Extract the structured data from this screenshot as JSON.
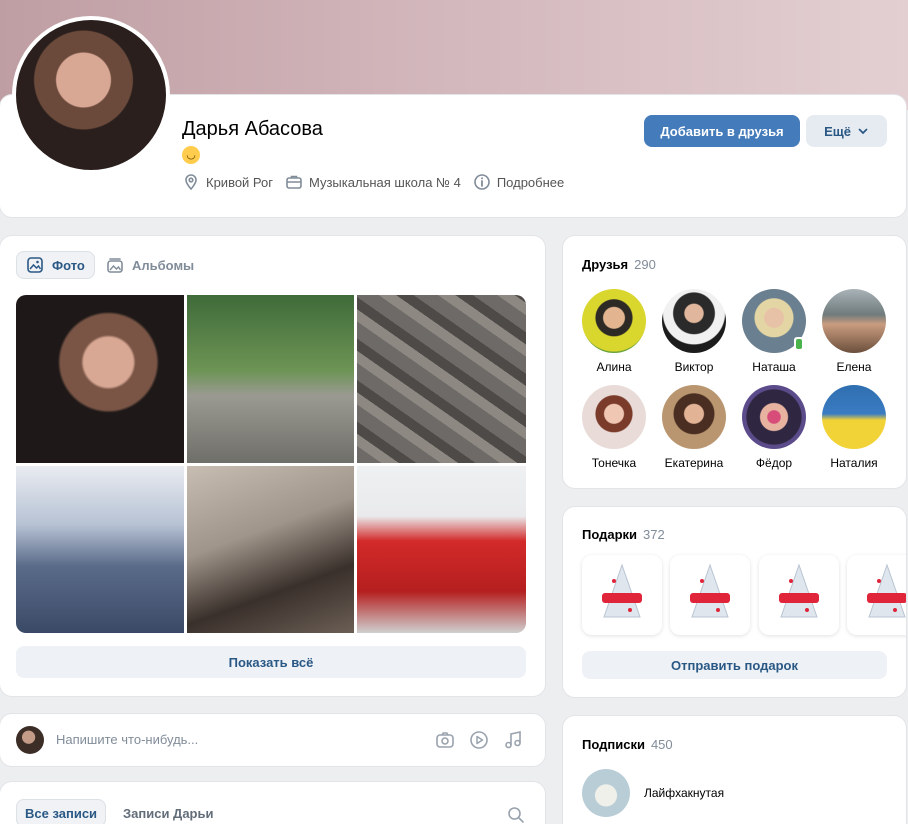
{
  "profile": {
    "name": "Дарья Абасова",
    "status_emoji": "😏",
    "city": "Кривой Рог",
    "school": "Музыкальная школа № 4",
    "more_info": "Подробнее",
    "add_friend_label": "Добавить в друзья",
    "more_label": "Ещё"
  },
  "photos": {
    "tabs": [
      {
        "label": "Фото",
        "active": true
      },
      {
        "label": "Альбомы",
        "active": false
      }
    ],
    "show_all_label": "Показать всё"
  },
  "post": {
    "placeholder": "Напишите что-нибудь..."
  },
  "wall": {
    "tabs": [
      {
        "label": "Все записи",
        "active": true
      },
      {
        "label": "Записи Дарьи",
        "active": false
      }
    ]
  },
  "friends": {
    "title": "Друзья",
    "count": "290",
    "items": [
      {
        "name": "Алина",
        "online": false
      },
      {
        "name": "Виктор",
        "online": false
      },
      {
        "name": "Наташа",
        "online": true
      },
      {
        "name": "Елена",
        "online": false
      },
      {
        "name": "Тонечка",
        "online": false
      },
      {
        "name": "Екатерина",
        "online": false
      },
      {
        "name": "Фёдор",
        "online": false
      },
      {
        "name": "Наталия",
        "online": false
      }
    ]
  },
  "gifts": {
    "title": "Подарки",
    "count": "372",
    "send_label": "Отправить подарок"
  },
  "subscriptions": {
    "title": "Подписки",
    "count": "450",
    "items": [
      {
        "name": "Лайфхакнутая"
      }
    ]
  },
  "colors": {
    "accent": "#447bba",
    "link": "#2a5885",
    "secondary_button": "#e5ebf1",
    "online": "#4bb34b",
    "background": "#edeef0"
  }
}
